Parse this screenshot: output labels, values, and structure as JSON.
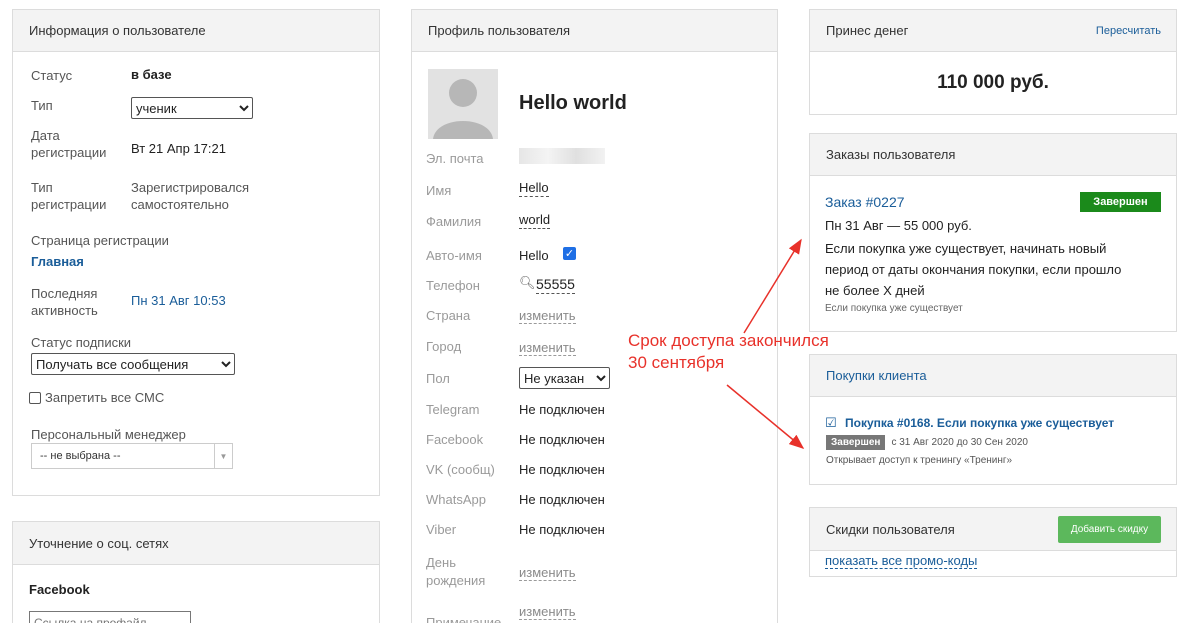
{
  "user_info": {
    "title": "Информация о пользователе",
    "status_label": "Статус",
    "status_value": "в базе",
    "type_label": "Тип",
    "type_value": "ученик",
    "reg_date_label_1": "Дата",
    "reg_date_label_2": "регистрации",
    "reg_date_value": "Вт 21 Апр 17:21",
    "reg_type_label_1": "Тип",
    "reg_type_label_2": "регистрации",
    "reg_type_value_1": "Зарегистрировался",
    "reg_type_value_2": "самостоятельно",
    "reg_page_label": "Страница регистрации",
    "reg_page_value": "Главная",
    "last_activity_label_1": "Последняя",
    "last_activity_label_2": "активность",
    "last_activity_value": "Пн 31 Авг 10:53",
    "subscription_label": "Статус подписки",
    "subscription_value": "Получать все сообщения",
    "sms_label": "Запретить все СМС",
    "manager_label": "Персональный менеджер",
    "manager_value": "-- не выбрана --"
  },
  "social": {
    "title": "Уточнение о соц. сетях",
    "facebook_label": "Facebook",
    "profile_placeholder": "Ссылка на профайл"
  },
  "profile": {
    "title": "Профиль пользователя",
    "name": "Hello world",
    "email_label": "Эл. почта",
    "first_name_label": "Имя",
    "first_name_value": "Hello",
    "last_name_label": "Фамилия",
    "last_name_value": "world",
    "auto_name_label": "Авто-имя",
    "auto_name_value": "Hello",
    "phone_label": "Телефон",
    "phone_value": "55555",
    "country_label": "Страна",
    "country_value": "изменить",
    "city_label": "Город",
    "city_value": "изменить",
    "gender_label": "Пол",
    "gender_value": "Не указан",
    "telegram_label": "Telegram",
    "telegram_value": "Не подключен",
    "facebook_label": "Facebook",
    "facebook_value": "Не подключен",
    "vk_label": "VK (сообщ)",
    "vk_value": "Не подключен",
    "whatsapp_label": "WhatsApp",
    "whatsapp_value": "Не подключен",
    "viber_label": "Viber",
    "viber_value": "Не подключен",
    "birthday_label_1": "День",
    "birthday_label_2": "рождения",
    "birthday_value": "изменить",
    "note_label": "Примечание",
    "note_value": "изменить"
  },
  "money": {
    "title": "Принес денег",
    "recalc": "Пересчитать",
    "amount": "110 000 руб."
  },
  "orders": {
    "title": "Заказы пользователя",
    "order_title": "Заказ #0227",
    "order_status": "Завершен",
    "order_date": "Пн 31 Авг — 55 000 руб.",
    "order_desc_1": "Если покупка уже существует, начинать новый",
    "order_desc_2": "период от даты окончания покупки, если прошло",
    "order_desc_3": "не более X дней",
    "order_note": "Если покупка уже существует"
  },
  "purchases": {
    "title": "Покупки клиента",
    "purchase_title": "Покупка #0168. Если покупка уже существует",
    "purchase_status": "Завершен",
    "purchase_period": "с 31 Авг 2020 до 30 Сен 2020",
    "purchase_access": "Открывает доступ к тренингу «Тренинг»"
  },
  "discounts": {
    "title": "Скидки пользователя",
    "add_button": "Добавить скидку",
    "show_promos": "показать все промо-коды"
  },
  "annotation": {
    "line1": "Срок доступа закончился",
    "line2": "30 сентября"
  },
  "colors": {
    "link": "#1a5d99",
    "annotation": "#e8312a",
    "badge_done": "#1b8a1b",
    "button_add": "#5cb85c"
  }
}
